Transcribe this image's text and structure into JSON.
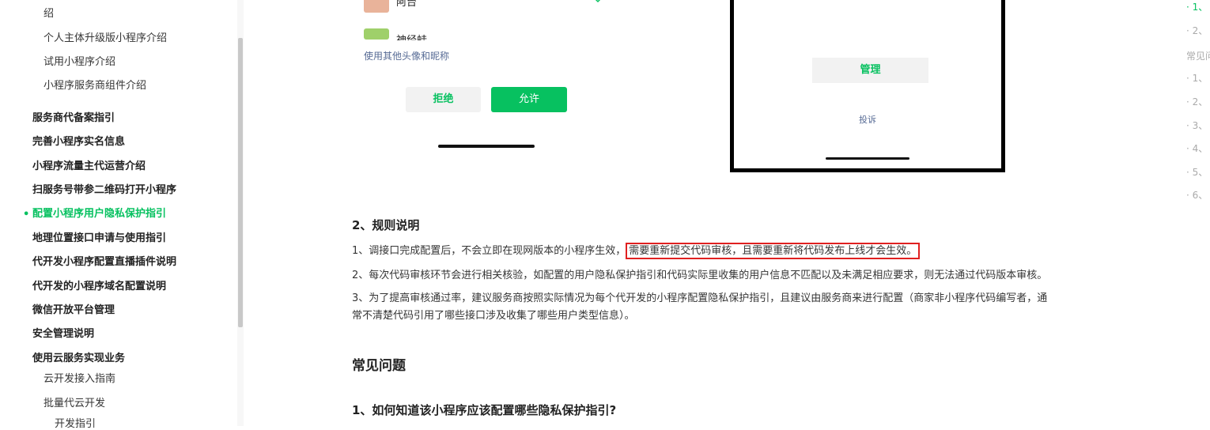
{
  "sidebar": {
    "items": [
      {
        "label": "绍"
      },
      {
        "label": "个人主体升级版小程序介绍"
      },
      {
        "label": "试用小程序介绍"
      },
      {
        "label": "小程序服务商组件介绍"
      },
      {
        "label": "服务商代备案指引"
      },
      {
        "label": "完善小程序实名信息"
      },
      {
        "label": "小程序流量主代运营介绍"
      },
      {
        "label": "扫服务号带参二维码打开小程序"
      },
      {
        "label": "配置小程序用户隐私保护指引"
      },
      {
        "label": "地理位置接口申请与使用指引"
      },
      {
        "label": "代开发小程序配置直播插件说明"
      },
      {
        "label": "代开发的小程序域名配置说明"
      },
      {
        "label": "微信开放平台管理"
      },
      {
        "label": "安全管理说明"
      },
      {
        "label": "使用云服务实现业务"
      },
      {
        "label": "云开发接入指南"
      },
      {
        "label": "批量代云开发"
      },
      {
        "label": "开发指引"
      }
    ],
    "active_dot": "•"
  },
  "mock_left": {
    "name1": "阿台",
    "name2": "神经蛙",
    "other_link": "使用其他头像和昵称",
    "reject": "拒绝",
    "allow": "允许"
  },
  "mock_right": {
    "manage": "管理",
    "complain": "投诉"
  },
  "article": {
    "section2_title": "2、规则说明",
    "rule1_prefix": "1、调接口完成配置后，不会立即在现网版本的小程序生效，",
    "rule1_highlight": "需要重新提交代码审核，且需要重新将代码发布上线才会生效。",
    "rule2": "2、每次代码审核环节会进行相关核验，如配置的用户隐私保护指引和代码实际里收集的用户信息不匹配以及未满足相应要求，则无法通过代码版本审核。",
    "rule3_line1": "3、为了提高审核通过率，建议服务商按照实际情况为每个代开发的小程序配置隐私保护指引，且建议由服务商来进行配置（商家非小程序代码编写者，通",
    "rule3_line2": "常不清楚代码引用了哪些接口涉及收集了哪些用户类型信息）。",
    "faq_title": "常见问题",
    "faq1_title": "1、如何知道该小程序应该配置哪些隐私保护指引?"
  },
  "toc": {
    "items": [
      "· 1、",
      "· 2、",
      "常见问",
      "· 1、",
      "· 2、",
      "· 3、",
      "· 4、",
      "· 5、",
      "· 6、"
    ]
  },
  "colors": {
    "accent": "#07c160",
    "highlight_border": "#e02020",
    "link": "#576b95"
  }
}
